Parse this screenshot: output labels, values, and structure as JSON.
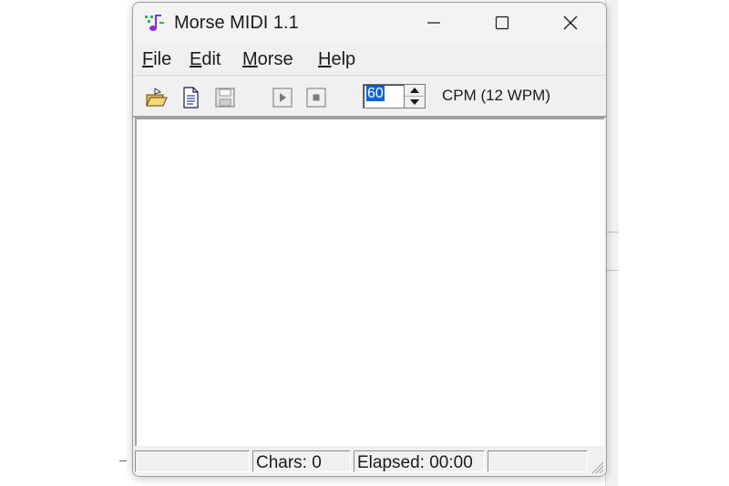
{
  "window": {
    "title": "Morse MIDI 1.1",
    "icon": "music-note-icon"
  },
  "menubar": {
    "items": [
      {
        "pre": "",
        "accel": "F",
        "rest": "ile"
      },
      {
        "pre": "",
        "accel": "E",
        "rest": "dit"
      },
      {
        "pre": "",
        "accel": "M",
        "rest": "orse"
      },
      {
        "pre": "",
        "accel": "H",
        "rest": "elp"
      }
    ]
  },
  "toolbar": {
    "icons": [
      "open-folder-icon",
      "new-document-icon",
      "save-disk-icon",
      "play-icon",
      "stop-icon"
    ],
    "speed_value": "60",
    "speed_label": "CPM (12 WPM)"
  },
  "statusbar": {
    "chars": "Chars: 0",
    "elapsed": "Elapsed: 00:00"
  },
  "colors": {
    "selection": "#0a64d8",
    "icon_green": "#2db84a",
    "icon_purple": "#8a2be2"
  }
}
